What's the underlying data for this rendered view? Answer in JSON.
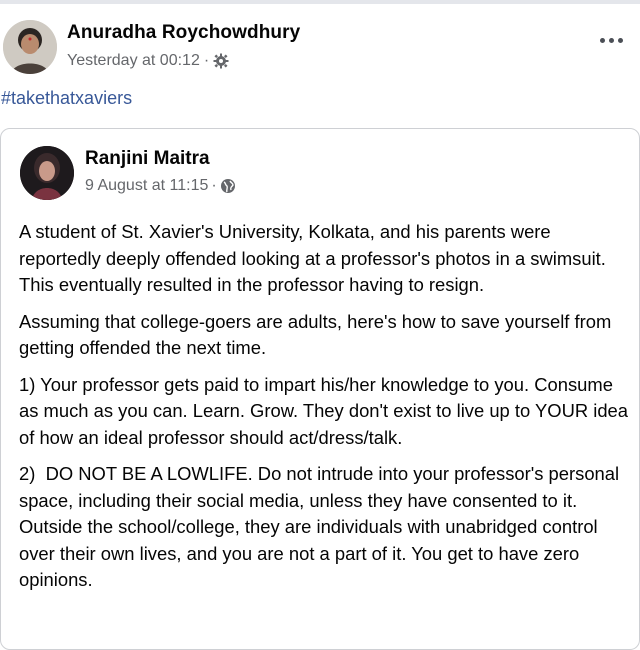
{
  "post": {
    "author": "Anuradha Roychowdhury",
    "timestamp": "Yesterday at 00:12",
    "separator": "·",
    "privacy_icon": "gear-icon",
    "more_icon": "more-options-icon",
    "hashtag": "#takethatxaviers"
  },
  "shared_post": {
    "author": "Ranjini Maitra",
    "timestamp": "9 August at 11:15",
    "separator": "·",
    "privacy_icon": "globe-icon",
    "paragraphs": [
      "A student of St. Xavier's University, Kolkata, and his parents were reportedly deeply offended looking at a professor's photos in a swimsuit. This eventually resulted in the professor having to resign.",
      "Assuming that college-goers are adults, here's how to save yourself from getting offended the next time.",
      "1) Your professor gets paid to impart his/her knowledge to you. Consume as much as you can. Learn. Grow. They don't exist to live up to YOUR idea of how an ideal professor should act/dress/talk.",
      "2)  DO NOT BE A LOWLIFE. Do not intrude into your professor's personal space, including their social media, unless they have consented to it. Outside the school/college, they are individuals with unabridged control over their own lives, and you are not a part of it. You get to have zero opinions."
    ]
  },
  "colors": {
    "link": "#385898",
    "secondary_text": "#65676b",
    "border": "#ced0d4"
  }
}
